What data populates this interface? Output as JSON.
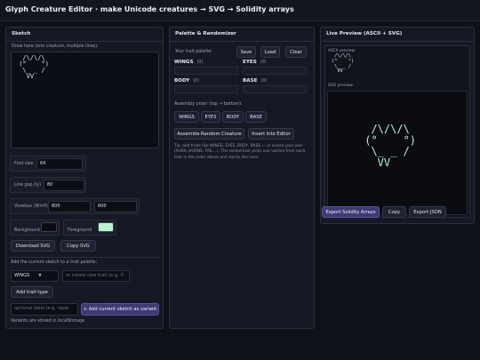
{
  "app": {
    "title": "Glyph Creature Editor · make Unicode creatures → SVG → Solidity arrays"
  },
  "sketch": {
    "title": "Sketch",
    "draw_label": "Draw here (one creature, multiple lines):",
    "draw_value": "  /\\/\\/\\\n (°    °)\n  \\_ _ /\n   VV",
    "font_size_label": "Font size",
    "font_size_value": "64",
    "line_gap_label": "Line gap (ly)",
    "line_gap_value": "80",
    "viewbox_label": "Viewbox (W×H)",
    "viewbox_w": "600",
    "viewbox_h": "600",
    "background_label": "Background",
    "background_color": "#0b0c12",
    "foreground_label": "Foreground",
    "foreground_color": "#b8f2cf",
    "download_svg": "Download SVG",
    "copy_svg": "Copy SVG",
    "add_to_palette_label": "Add the current sketch to a trait palette:",
    "trait_select_value": "WINGS",
    "new_trait_placeholder": "or create new trait (e.g. ©",
    "add_trait_type": "Add trait type",
    "optional_label_placeholder": "optional label (e.g. rippe",
    "add_variant": "+ Add current sketch as variant",
    "storage_note": "Variants are stored in localStorage."
  },
  "palette": {
    "title": "Palette & Randomizer",
    "your_palette_label": "Your trait palette:",
    "save": "Save",
    "load": "Load",
    "clear": "Clear",
    "traits": [
      {
        "name": "WINGS",
        "count": "(0)"
      },
      {
        "name": "EYES",
        "count": "(0)"
      },
      {
        "name": "BODY",
        "count": "(0)"
      },
      {
        "name": "BASE",
        "count": "(0)"
      }
    ],
    "assembly_label": "Assembly order (top → bottom):",
    "order": [
      "WINGS",
      "EYES",
      "BODY",
      "BASE"
    ],
    "assemble": "Assemble Random Creature",
    "insert": "Insert Into Editor",
    "tip": "Tip: add traits like WINGS, EYES, BODY, BASE — or invent your own (AURA, HORNS, TAIL…). The randomizer picks one variant from each trait in the order above and stacks the lines."
  },
  "preview": {
    "title": "Live Preview (ASCII + SVG)",
    "ascii_label": "ASCII preview",
    "svg_label": "SVG preview",
    "export_solidity": "Export Solidity Arrays",
    "copy": "Copy",
    "export_json": "Export JSON"
  },
  "icons": {
    "dropdown": "chevron-down-icon"
  }
}
